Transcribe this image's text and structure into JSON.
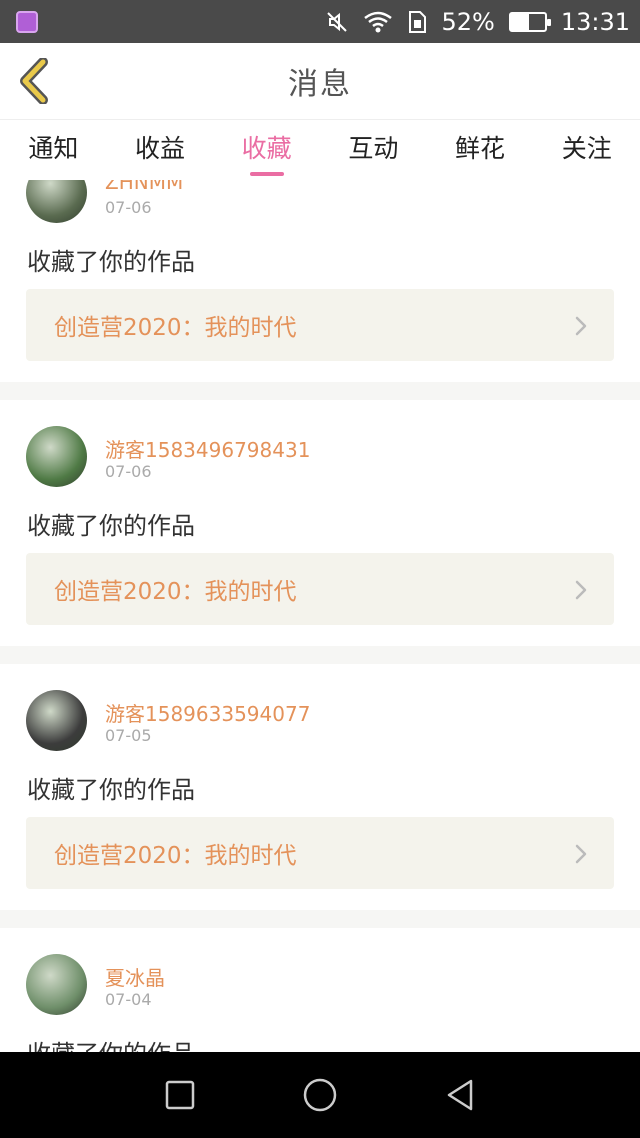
{
  "status_bar": {
    "battery": "52%",
    "battery_level": 0.52,
    "time": "13:31"
  },
  "header": {
    "title": "消息"
  },
  "tabs": [
    {
      "label": "通知",
      "active": false
    },
    {
      "label": "收益",
      "active": false
    },
    {
      "label": "收藏",
      "active": true
    },
    {
      "label": "互动",
      "active": false
    },
    {
      "label": "鲜花",
      "active": false
    },
    {
      "label": "关注",
      "active": false
    }
  ],
  "notifications": [
    {
      "user": "ZHNMM",
      "date": "07-06",
      "action": "收藏了你的作品",
      "work": "创造营2020：我的时代",
      "avatar_color": "#5a6b50"
    },
    {
      "user": "游客1583496798431",
      "date": "07-06",
      "action": "收藏了你的作品",
      "work": "创造营2020：我的时代",
      "avatar_color": "#4f7a45"
    },
    {
      "user": "游客1589633594077",
      "date": "07-05",
      "action": "收藏了你的作品",
      "work": "创造营2020：我的时代",
      "avatar_color": "#3c3c3c"
    },
    {
      "user": "夏冰晶",
      "date": "07-04",
      "action": "收藏了你的作品",
      "work": "",
      "avatar_color": "#6f8f6a"
    }
  ],
  "colors": {
    "accent": "#ea6da3",
    "username": "#e4925a",
    "back_icon": "#e9c94a"
  }
}
